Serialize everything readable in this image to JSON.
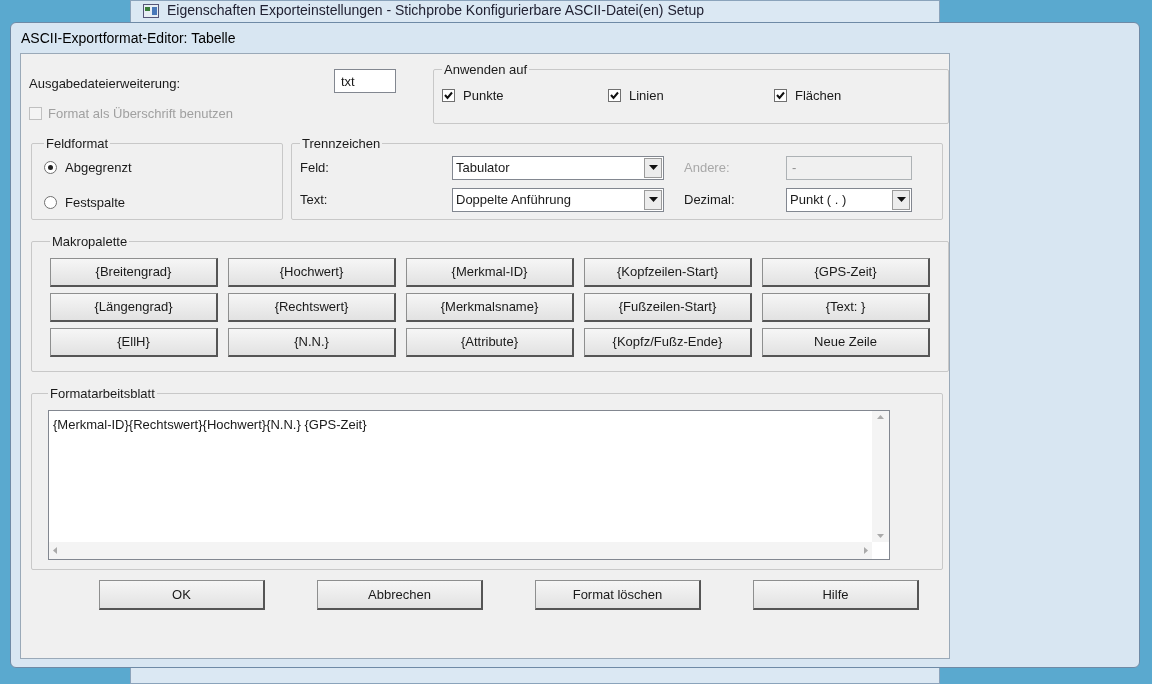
{
  "background_window": {
    "title": "Eigenschaften Exporteinstellungen - Stichprobe Konfigurierbare ASCII-Datei(en) Setup"
  },
  "dialog": {
    "title": "ASCII-Exportformat-Editor: Tabelle"
  },
  "extension": {
    "label": "Ausgabedateierweiterung:",
    "value": "txt"
  },
  "header_option": {
    "label": "Format als Überschrift benutzen",
    "checked": false,
    "disabled": true
  },
  "apply_to": {
    "title": "Anwenden auf",
    "items": [
      {
        "label": "Punkte",
        "checked": true
      },
      {
        "label": "Linien",
        "checked": true
      },
      {
        "label": "Flächen",
        "checked": true
      }
    ]
  },
  "field_format": {
    "title": "Feldformat",
    "options": [
      {
        "label": "Abgegrenzt",
        "selected": true
      },
      {
        "label": "Festspalte",
        "selected": false
      }
    ]
  },
  "separators": {
    "title": "Trennzeichen",
    "fields": [
      {
        "label": "Feld:",
        "value": "Tabulator",
        "kind": "dropdown",
        "disabled": false
      },
      {
        "label": "Andere:",
        "value": "-",
        "kind": "text",
        "disabled": true
      },
      {
        "label": "Text:",
        "value": "Doppelte Anführung",
        "kind": "dropdown",
        "disabled": false
      },
      {
        "label": "Dezimal:",
        "value": "Punkt ( . )",
        "kind": "dropdown",
        "disabled": false
      }
    ]
  },
  "macro_palette": {
    "title": "Makropalette",
    "buttons": [
      "{Breitengrad}",
      "{Hochwert}",
      "{Merkmal-ID}",
      "{Kopfzeilen-Start}",
      "{GPS-Zeit}",
      "{Längengrad}",
      "{Rechtswert}",
      "{Merkmalsname}",
      "{Fußzeilen-Start}",
      "{Text: }",
      "{EllH}",
      "{N.N.}",
      "{Attribute}",
      "{Kopfz/Fußz-Ende}",
      "Neue Zeile"
    ]
  },
  "worksheet": {
    "title": "Formatarbeitsblatt",
    "value": "{Merkmal-ID}{Rechtswert}{Hochwert}{N.N.} {GPS-Zeit}"
  },
  "buttons": [
    "OK",
    "Abbrechen",
    "Format löschen",
    "Hilfe"
  ]
}
